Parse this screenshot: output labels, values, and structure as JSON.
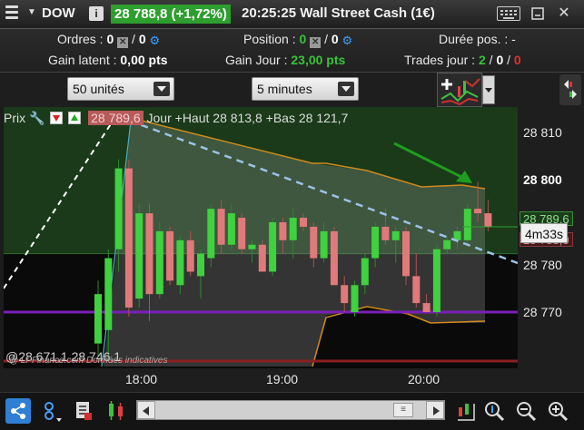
{
  "topbar": {
    "symbol": "DOW",
    "info_label": "i",
    "price_change": "28 788,8 (+1,72%)",
    "time_title": "20:25:25 Wall Street Cash (1€)",
    "close_label": "✕"
  },
  "stats": {
    "orders_label": "Ordres :",
    "orders_value_1": "0",
    "orders_value_2": "0",
    "position_label": "Position :",
    "position_value_1": "0",
    "position_value_2": "0",
    "duree_label": "Durée pos. :",
    "duree_value": "-",
    "gain_latent_label": "Gain latent :",
    "gain_latent_value": "0,00 pts",
    "gain_jour_label": "Gain Jour :",
    "gain_jour_value": "23,00 pts",
    "trades_label": "Trades jour :",
    "trades_win": "2",
    "trades_sep1": "/",
    "trades_neutral": "0",
    "trades_sep2": "/",
    "trades_loss": "0",
    "slash": "/"
  },
  "controls": {
    "quantity_select": "50 unités",
    "interval_select": "5 minutes"
  },
  "chart": {
    "head_label": "Prix",
    "last_badge": "28 789,6",
    "head_text": "Jour +Haut 28 813,8 +Bas 28 121,7",
    "foot_text": "@28 671,1 28 746,1",
    "watermark": "@ Lr-Finance.com Données indicatives",
    "price_box_green": "28 789,6",
    "price_box_red": "28 788,0",
    "countdown": "4m33s",
    "y_labels": [
      "28 810",
      "28 800",
      "28 790",
      "28 780",
      "28 770"
    ],
    "x_labels": [
      "18:00",
      "19:00",
      "20:00"
    ],
    "colors": {
      "up": "#3fd13f",
      "down": "#e07a7a",
      "trend": "#9ac3e8",
      "support": "#7b1fb8",
      "band": "#d08a1a",
      "arrow": "#1f9d1f"
    }
  },
  "chart_data": {
    "type": "candlestick",
    "title": "",
    "y_ticks": [
      28810,
      28800,
      28790,
      28780,
      28770
    ],
    "x_ticks": [
      "18:00",
      "19:00",
      "20:00"
    ],
    "candles": [
      {
        "o": 28763,
        "h": 28777,
        "l": 28760,
        "c": 28774
      },
      {
        "o": 28766,
        "h": 28784,
        "l": 28760,
        "c": 28782
      },
      {
        "o": 28784,
        "h": 28804,
        "l": 28779,
        "c": 28802
      },
      {
        "o": 28802,
        "h": 28804,
        "l": 28769,
        "c": 28771
      },
      {
        "o": 28773,
        "h": 28794,
        "l": 28771,
        "c": 28792
      },
      {
        "o": 28792,
        "h": 28794,
        "l": 28768,
        "c": 28774
      },
      {
        "o": 28774,
        "h": 28790,
        "l": 28773,
        "c": 28788
      },
      {
        "o": 28788,
        "h": 28789,
        "l": 28776,
        "c": 28777
      },
      {
        "o": 28776,
        "h": 28787,
        "l": 28774,
        "c": 28786
      },
      {
        "o": 28786,
        "h": 28788,
        "l": 28778,
        "c": 28779
      },
      {
        "o": 28778,
        "h": 28784,
        "l": 28773,
        "c": 28783
      },
      {
        "o": 28782,
        "h": 28794,
        "l": 28780,
        "c": 28793
      },
      {
        "o": 28793,
        "h": 28795,
        "l": 28783,
        "c": 28785
      },
      {
        "o": 28785,
        "h": 28794,
        "l": 28784,
        "c": 28792
      },
      {
        "o": 28791,
        "h": 28792,
        "l": 28783,
        "c": 28784
      },
      {
        "o": 28784,
        "h": 28786,
        "l": 28781,
        "c": 28785
      },
      {
        "o": 28785,
        "h": 28786,
        "l": 28779,
        "c": 28779
      },
      {
        "o": 28779,
        "h": 28791,
        "l": 28778,
        "c": 28790
      },
      {
        "o": 28790,
        "h": 28791,
        "l": 28783,
        "c": 28786
      },
      {
        "o": 28786,
        "h": 28793,
        "l": 28782,
        "c": 28791
      },
      {
        "o": 28791,
        "h": 28792,
        "l": 28788,
        "c": 28789
      },
      {
        "o": 28789,
        "h": 28790,
        "l": 28780,
        "c": 28782
      },
      {
        "o": 28782,
        "h": 28790,
        "l": 28781,
        "c": 28788
      },
      {
        "o": 28788,
        "h": 28789,
        "l": 28776,
        "c": 28776
      },
      {
        "o": 28776,
        "h": 28778,
        "l": 28770,
        "c": 28772
      },
      {
        "o": 28770,
        "h": 28777,
        "l": 28769,
        "c": 28776
      },
      {
        "o": 28776,
        "h": 28783,
        "l": 28774,
        "c": 28782
      },
      {
        "o": 28782,
        "h": 28790,
        "l": 28780,
        "c": 28789
      },
      {
        "o": 28789,
        "h": 28793,
        "l": 28785,
        "c": 28786
      },
      {
        "o": 28786,
        "h": 28789,
        "l": 28781,
        "c": 28788
      },
      {
        "o": 28788,
        "h": 28789,
        "l": 28776,
        "c": 28778
      },
      {
        "o": 28778,
        "h": 28783,
        "l": 28771,
        "c": 28772
      },
      {
        "o": 28772,
        "h": 28774,
        "l": 28770,
        "c": 28770
      },
      {
        "o": 28770,
        "h": 28785,
        "l": 28769,
        "c": 28784
      },
      {
        "o": 28784,
        "h": 28787,
        "l": 28783,
        "c": 28786
      },
      {
        "o": 28786,
        "h": 28789,
        "l": 28784,
        "c": 28788
      },
      {
        "o": 28786,
        "h": 28794,
        "l": 28785,
        "c": 28793
      },
      {
        "o": 28793,
        "h": 28799,
        "l": 28790,
        "c": 28792
      },
      {
        "o": 28792,
        "h": 28795,
        "l": 28788,
        "c": 28789
      }
    ]
  },
  "bottombar": {
    "share_label": "<",
    "thumb_label": "≡"
  }
}
